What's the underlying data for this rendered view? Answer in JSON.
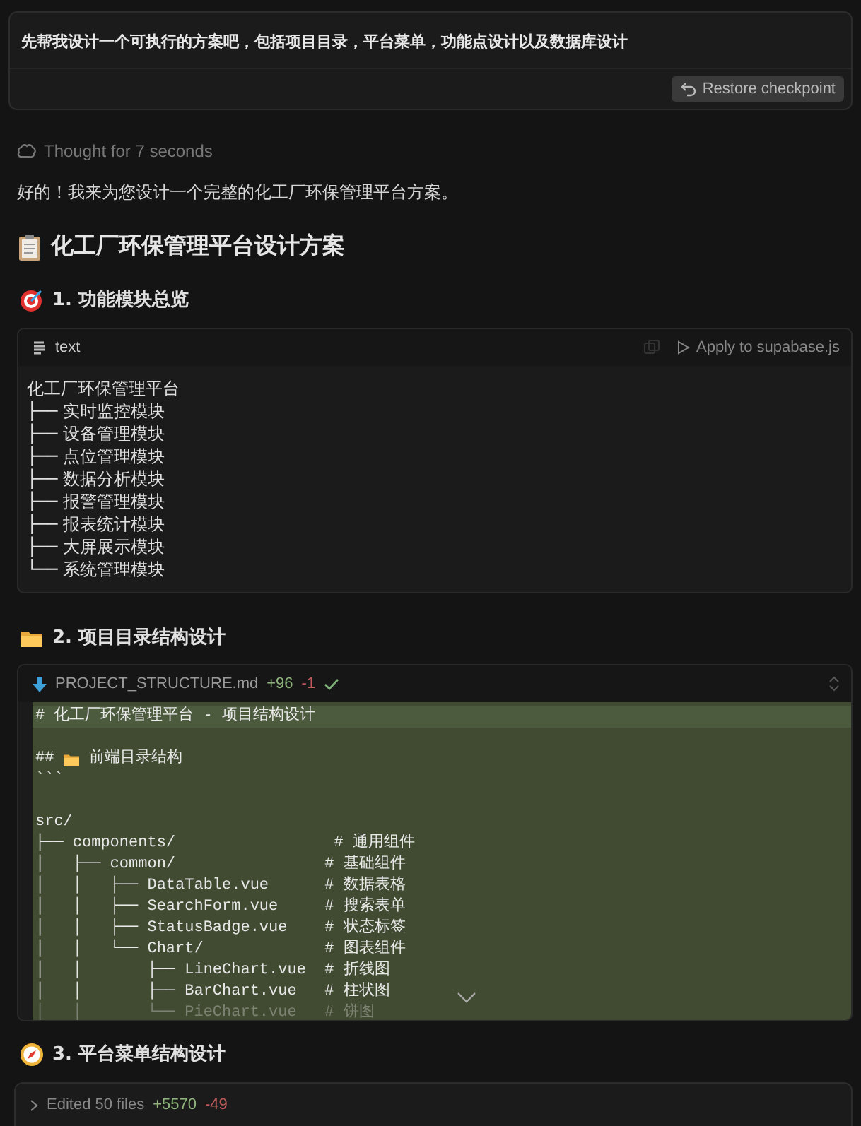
{
  "user_message": {
    "text": "先帮我设计一个可执行的方案吧，包括项目目录，平台菜单，功能点设计以及数据库设计",
    "restore_button": "Restore checkpoint"
  },
  "thought": "Thought for 7 seconds",
  "intro": "好的！我来为您设计一个完整的化工厂环保管理平台方案。",
  "title": "化工厂环保管理平台设计方案",
  "section_1_heading": "1. 功能模块总览",
  "overview_block": {
    "language": "text",
    "apply_action": "Apply to supabase.js",
    "lines": [
      "化工厂环保管理平台",
      "├── 实时监控模块",
      "├── 设备管理模块",
      "├── 点位管理模块",
      "├── 数据分析模块",
      "├── 报警管理模块",
      "├── 报表统计模块",
      "├── 大屏展示模块",
      "└── 系统管理模块"
    ]
  },
  "section_2_heading": "2. 项目目录结构设计",
  "file_block": {
    "file_name": "PROJECT_STRUCTURE.md",
    "additions": "+96",
    "deletions": "-1",
    "lines": [
      {
        "kind": "plain",
        "text": "# 化工厂环保管理平台 - 项目结构设计",
        "highlighted": true,
        "faded": false
      },
      {
        "kind": "blank"
      },
      {
        "kind": "folder",
        "prefix": "##",
        "text": "前端目录结构",
        "highlighted": false,
        "faded": false
      },
      {
        "kind": "plain",
        "text": "```",
        "highlighted": false,
        "faded": false
      },
      {
        "kind": "blank"
      },
      {
        "kind": "plain",
        "text": "src/",
        "highlighted": false,
        "faded": false
      },
      {
        "kind": "plain",
        "text": "├── components/                 # 通用组件",
        "highlighted": false,
        "faded": false
      },
      {
        "kind": "plain",
        "text": "│   ├── common/                # 基础组件",
        "highlighted": false,
        "faded": false
      },
      {
        "kind": "plain",
        "text": "│   │   ├── DataTable.vue      # 数据表格",
        "highlighted": false,
        "faded": false
      },
      {
        "kind": "plain",
        "text": "│   │   ├── SearchForm.vue     # 搜索表单",
        "highlighted": false,
        "faded": false
      },
      {
        "kind": "plain",
        "text": "│   │   ├── StatusBadge.vue    # 状态标签",
        "highlighted": false,
        "faded": false
      },
      {
        "kind": "plain",
        "text": "│   │   └── Chart/             # 图表组件",
        "highlighted": false,
        "faded": false
      },
      {
        "kind": "plain",
        "text": "│   │       ├── LineChart.vue  # 折线图",
        "highlighted": false,
        "faded": false
      },
      {
        "kind": "plain",
        "text": "│   │       ├── BarChart.vue   # 柱状图",
        "highlighted": false,
        "faded": false
      },
      {
        "kind": "plain",
        "text": "│   │       └── PieChart.vue   # 饼图",
        "highlighted": false,
        "faded": true
      }
    ]
  },
  "section_3_heading": "3. 平台菜单结构设计",
  "edits_bar": {
    "label": "Edited 50 files",
    "additions": "+5570",
    "deletions": "-49"
  }
}
